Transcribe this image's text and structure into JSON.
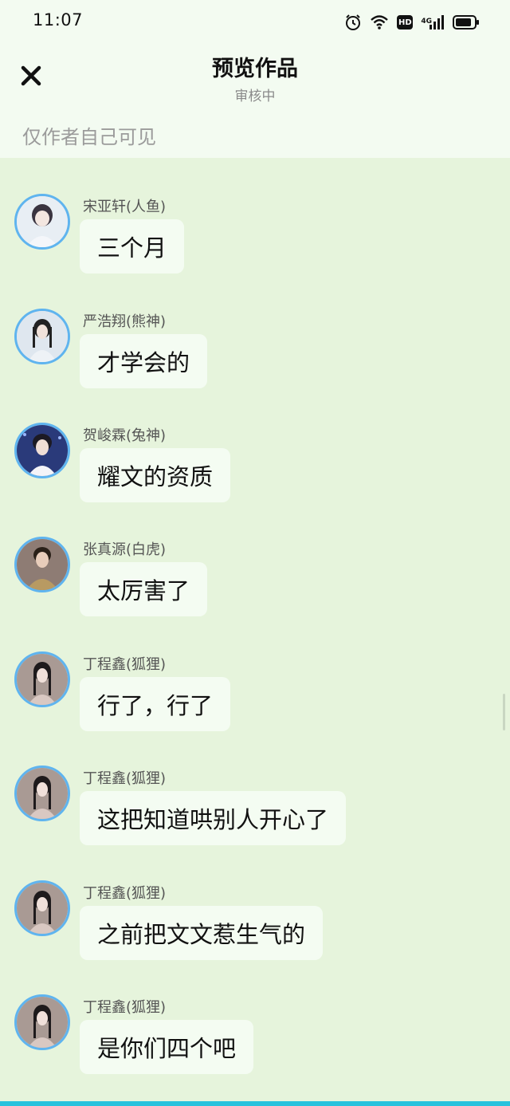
{
  "status_bar": {
    "time": "11:07",
    "hd": "HD",
    "network": "4G",
    "icons": [
      "alarm-icon",
      "wifi-icon",
      "hd-icon",
      "signal-icon",
      "battery-icon"
    ]
  },
  "header": {
    "title": "预览作品",
    "subtitle": "审核中",
    "visibility_note": "仅作者自己可见",
    "close_icon": "close-icon"
  },
  "colors": {
    "background": "#e6f4dc",
    "header_bg": "#f3fbf1",
    "bubble_bg": "#f4fcf2",
    "avatar_ring": "#5fb4ef",
    "bottom_bar": "#27c2dd"
  },
  "messages": [
    {
      "name": "宋亚轩(人鱼)",
      "text": "三个月"
    },
    {
      "name": "严浩翔(熊神)",
      "text": "才学会的"
    },
    {
      "name": "贺峻霖(兔神)",
      "text": "耀文的资质"
    },
    {
      "name": "张真源(白虎)",
      "text": "太厉害了"
    },
    {
      "name": "丁程鑫(狐狸)",
      "text": "行了，行了"
    },
    {
      "name": "丁程鑫(狐狸)",
      "text": "这把知道哄别人开心了"
    },
    {
      "name": "丁程鑫(狐狸)",
      "text": "之前把文文惹生气的"
    },
    {
      "name": "丁程鑫(狐狸)",
      "text": "是你们四个吧"
    }
  ]
}
